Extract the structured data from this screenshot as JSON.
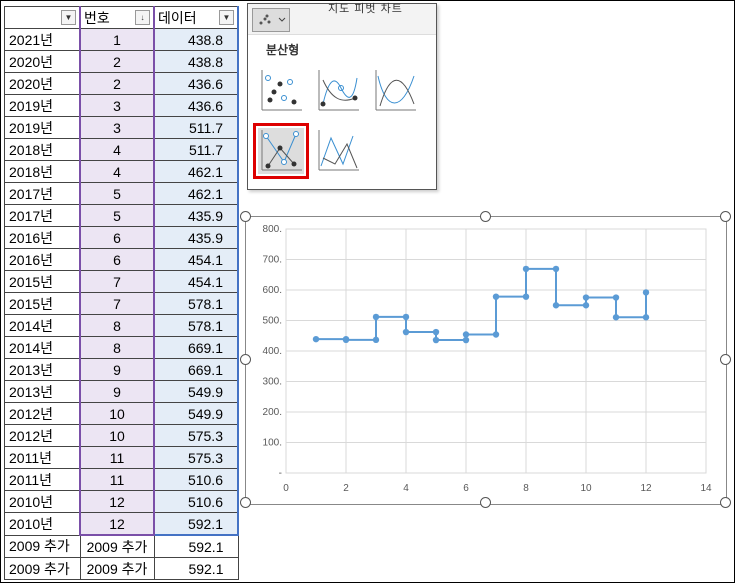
{
  "table": {
    "headers": [
      "",
      "번호",
      "데이터"
    ],
    "rows": [
      [
        "2021년",
        "1",
        "438.8"
      ],
      [
        "2020년",
        "2",
        "438.8"
      ],
      [
        "2020년",
        "2",
        "436.6"
      ],
      [
        "2019년",
        "3",
        "436.6"
      ],
      [
        "2019년",
        "3",
        "511.7"
      ],
      [
        "2018년",
        "4",
        "511.7"
      ],
      [
        "2018년",
        "4",
        "462.1"
      ],
      [
        "2017년",
        "5",
        "462.1"
      ],
      [
        "2017년",
        "5",
        "435.9"
      ],
      [
        "2016년",
        "6",
        "435.9"
      ],
      [
        "2016년",
        "6",
        "454.1"
      ],
      [
        "2015년",
        "7",
        "454.1"
      ],
      [
        "2015년",
        "7",
        "578.1"
      ],
      [
        "2014년",
        "8",
        "578.1"
      ],
      [
        "2014년",
        "8",
        "669.1"
      ],
      [
        "2013년",
        "9",
        "669.1"
      ],
      [
        "2013년",
        "9",
        "549.9"
      ],
      [
        "2012년",
        "10",
        "549.9"
      ],
      [
        "2012년",
        "10",
        "575.3"
      ],
      [
        "2011년",
        "11",
        "575.3"
      ],
      [
        "2011년",
        "11",
        "510.6"
      ],
      [
        "2010년",
        "12",
        "510.6"
      ],
      [
        "2010년",
        "12",
        "592.1"
      ]
    ],
    "extra_rows": [
      [
        "2009 추가",
        "2009 추가",
        "592.1"
      ],
      [
        "2009 추가",
        "2009 추가",
        "592.1"
      ]
    ]
  },
  "gallery": {
    "top_labels": "지도   피벗 차트",
    "title": "분산형",
    "icons": [
      "scatter-markers-icon",
      "scatter-smooth-markers-icon",
      "scatter-smooth-lines-icon",
      "scatter-straight-markers-icon",
      "scatter-straight-lines-icon"
    ]
  },
  "chart_data": {
    "type": "line",
    "x": [
      1,
      2,
      2,
      3,
      3,
      4,
      4,
      5,
      5,
      6,
      6,
      7,
      7,
      8,
      8,
      9,
      9,
      10,
      10,
      11,
      11,
      12,
      12
    ],
    "y": [
      438.8,
      438.8,
      436.6,
      436.6,
      511.7,
      511.7,
      462.1,
      462.1,
      435.9,
      435.9,
      454.1,
      454.1,
      578.1,
      578.1,
      669.1,
      669.1,
      549.9,
      549.9,
      575.3,
      575.3,
      510.6,
      510.6,
      592.1
    ],
    "xlim": [
      0,
      14
    ],
    "ylim": [
      0,
      800
    ],
    "xticks": [
      "0",
      "2",
      "4",
      "6",
      "8",
      "10",
      "12",
      "14"
    ],
    "yticks": [
      "-",
      "100.",
      "200.",
      "300.",
      "400.",
      "500.",
      "600.",
      "700.",
      "800."
    ],
    "color": "#5b9bd5"
  }
}
